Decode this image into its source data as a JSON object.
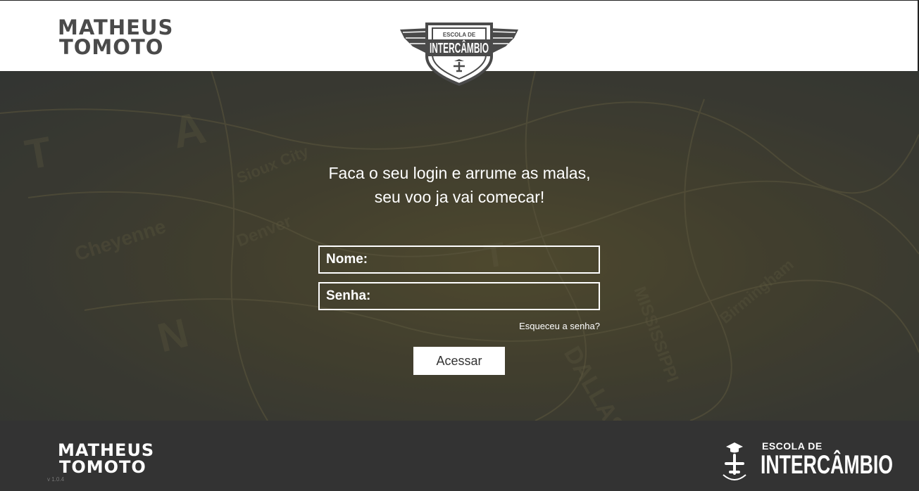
{
  "header": {
    "brand_line1": "MATHEUS",
    "brand_line2": "TOMOTO",
    "crest_top": "ESCOLA DE",
    "crest_main": "INTERCÂMBIO"
  },
  "login": {
    "headline_line1": "Faca o seu login e arrume as malas,",
    "headline_line2": "seu voo ja vai comecar!",
    "name_label": "Nome:",
    "name_value": "",
    "password_label": "Senha:",
    "password_value": "",
    "forgot_link": "Esqueceu a senha?",
    "submit_label": "Acessar"
  },
  "footer": {
    "brand_line1": "MATHEUS",
    "brand_line2": "TOMOTO",
    "version": "v 1.0.4",
    "school_top": "ESCOLA DE",
    "school_main": "INTERCÂMBIO"
  },
  "colors": {
    "header_bg": "#ffffff",
    "footer_bg": "#333333",
    "brand_dark": "#4a4a4a",
    "text_light": "#ffffff"
  }
}
